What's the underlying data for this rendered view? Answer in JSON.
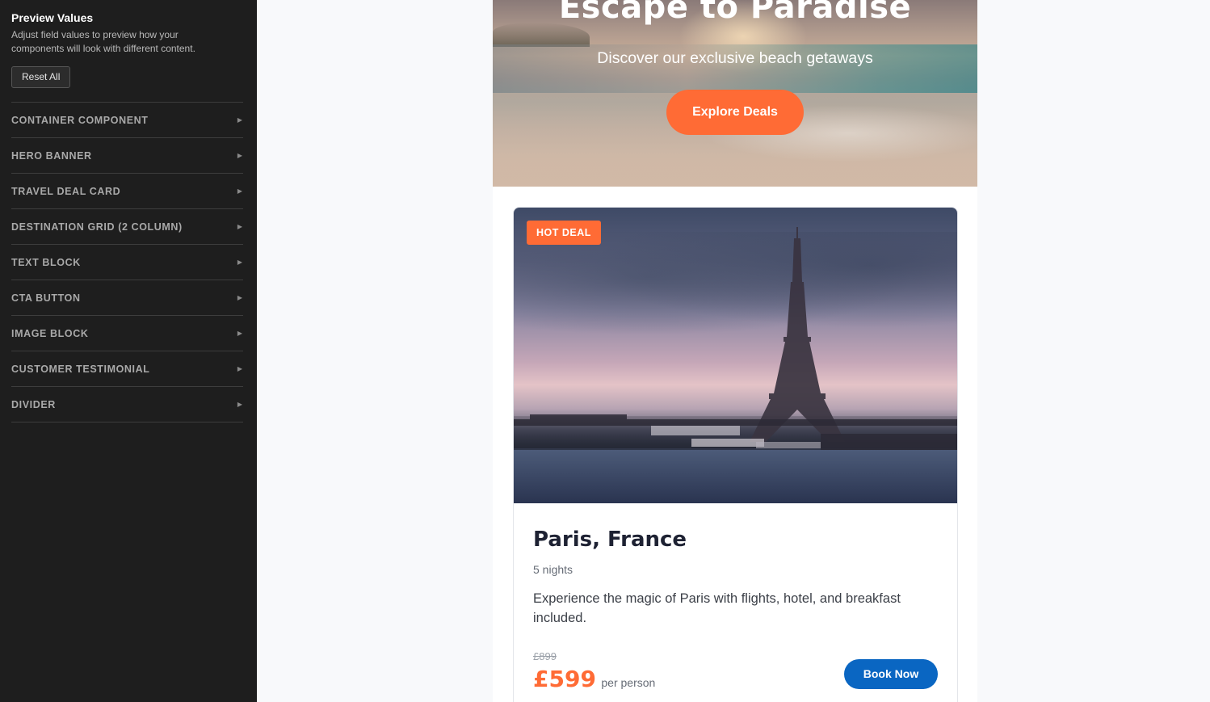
{
  "sidebar": {
    "title": "Preview Values",
    "description": "Adjust field values to preview how your components will look with different content.",
    "reset_label": "Reset All",
    "items": [
      {
        "label": "CONTAINER COMPONENT"
      },
      {
        "label": "HERO BANNER"
      },
      {
        "label": "TRAVEL DEAL CARD"
      },
      {
        "label": "DESTINATION GRID (2 COLUMN)"
      },
      {
        "label": "TEXT BLOCK"
      },
      {
        "label": "CTA BUTTON"
      },
      {
        "label": "IMAGE BLOCK"
      },
      {
        "label": "CUSTOMER TESTIMONIAL"
      },
      {
        "label": "DIVIDER"
      }
    ],
    "arrow_icon": "▶"
  },
  "hero": {
    "title": "Escape to Paradise",
    "subtitle": "Discover our exclusive beach getaways",
    "cta_label": "Explore Deals"
  },
  "deal": {
    "badge": "HOT DEAL",
    "destination": "Paris, France",
    "nights": "5 nights",
    "description": "Experience the magic of Paris with flights, hotel, and breakfast included.",
    "old_price": "£899",
    "price": "£599",
    "price_unit": "per person",
    "cta_label": "Book Now"
  },
  "colors": {
    "accent": "#ff6b35",
    "primary_button": "#0a66c2",
    "sidebar_bg": "#1e1e1e"
  }
}
